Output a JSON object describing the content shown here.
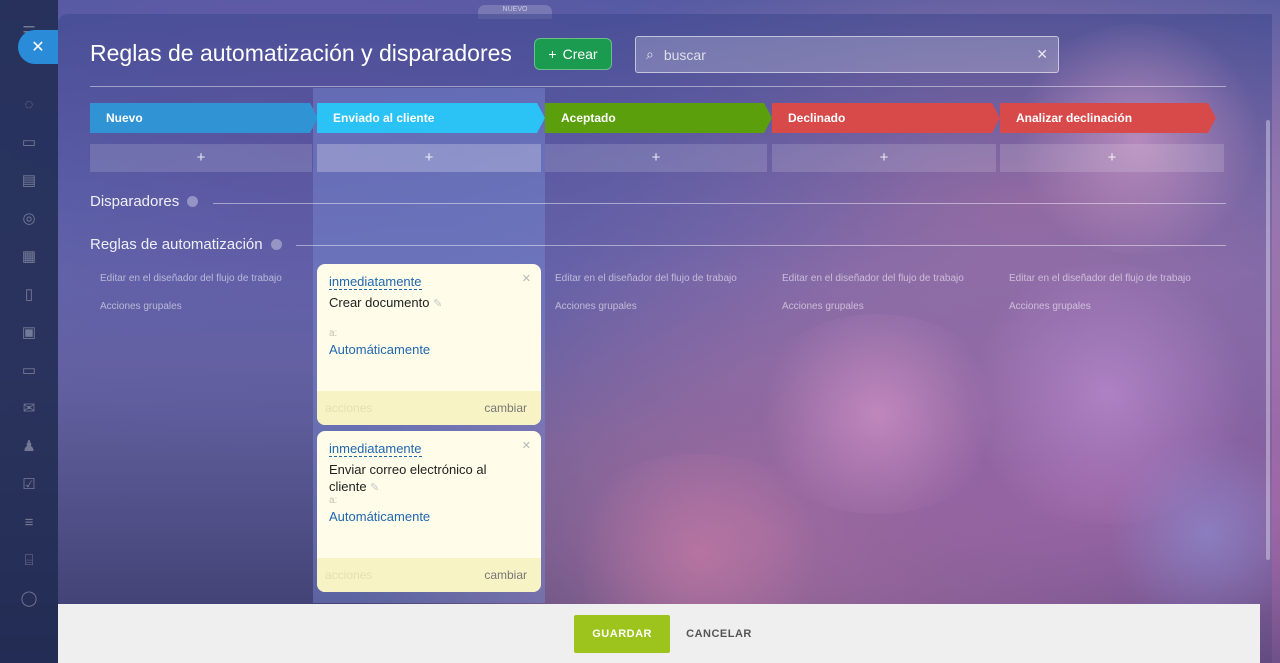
{
  "window": {
    "top_tab": "NUEVO"
  },
  "header": {
    "title": "Reglas de automatización y disparadores",
    "create_label": "Crear",
    "search_placeholder": "buscar"
  },
  "stages": [
    {
      "label": "Nuevo",
      "color": "#2f93d4"
    },
    {
      "label": "Enviado al cliente",
      "color": "#2bc3f5"
    },
    {
      "label": "Aceptado",
      "color": "#5ba00c"
    },
    {
      "label": "Declinado",
      "color": "#d84a4a"
    },
    {
      "label": "Analizar declinación",
      "color": "#d84a4a"
    }
  ],
  "plus_symbol": "+",
  "sections": {
    "triggers": "Disparadores",
    "automation_rules": "Reglas de automatización"
  },
  "column_links": {
    "edit_designer": "Editar en el diseñador del flujo de trabajo",
    "group_actions": "Acciones grupales"
  },
  "cards": [
    {
      "timing": "inmediatamente",
      "name": "Crear documento",
      "to_label": "a:",
      "to_value": "Automáticamente",
      "actions_label": "acciones",
      "change_label": "cambiar"
    },
    {
      "timing": "inmediatamente",
      "name": "Enviar correo electrónico al cliente",
      "to_label": "a:",
      "to_value": "Automáticamente",
      "actions_label": "acciones",
      "change_label": "cambiar"
    }
  ],
  "footer": {
    "save_label": "GUARDAR",
    "cancel_label": "CANCELAR"
  }
}
